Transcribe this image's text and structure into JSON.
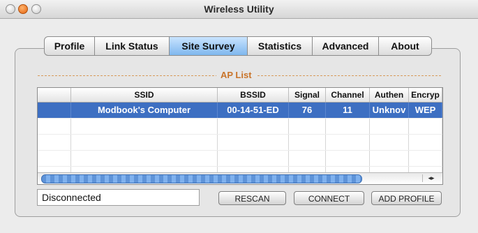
{
  "window": {
    "title": "Wireless Utility"
  },
  "tabs": [
    "Profile",
    "Link Status",
    "Site Survey",
    "Statistics",
    "Advanced",
    "About"
  ],
  "selected_tab": "Site Survey",
  "ap_list": {
    "label": "AP List",
    "columns": [
      "",
      "SSID",
      "BSSID",
      "Signal",
      "Channel",
      "Authen",
      "Encryp"
    ],
    "rows": [
      [
        "",
        "Modbook's Computer",
        "00-14-51-ED",
        "76",
        "11",
        "Unknov",
        "WEP"
      ]
    ]
  },
  "status": {
    "text": "Disconnected"
  },
  "buttons": {
    "rescan": "RESCAN",
    "connect": "CONNECT",
    "add_profile": "ADD PROFILE"
  },
  "colors": {
    "selection": "#3d6fc2",
    "tab_selected": "#7fb7ee",
    "ap_label": "#c9742a"
  }
}
